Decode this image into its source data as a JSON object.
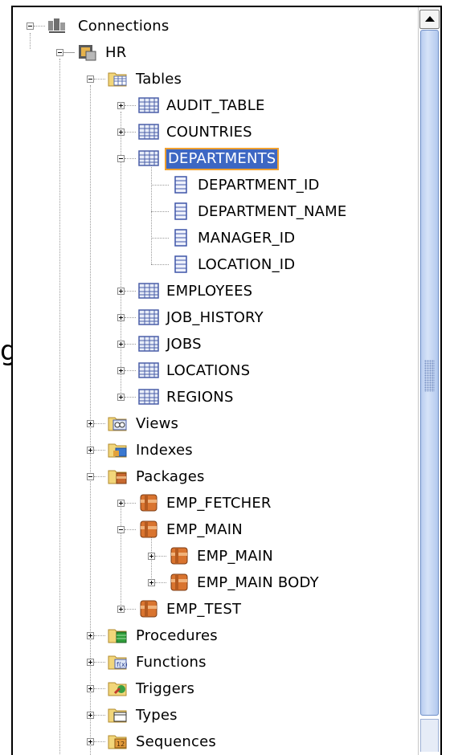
{
  "tree": {
    "connections": "Connections",
    "hr": "HR",
    "tables": {
      "label": "Tables",
      "items": [
        "AUDIT_TABLE",
        "COUNTRIES",
        "DEPARTMENTS",
        "EMPLOYEES",
        "JOB_HISTORY",
        "JOBS",
        "LOCATIONS",
        "REGIONS"
      ]
    },
    "department_columns": [
      "DEPARTMENT_ID",
      "DEPARTMENT_NAME",
      "MANAGER_ID",
      "LOCATION_ID"
    ],
    "views": "Views",
    "indexes": "Indexes",
    "packages": {
      "label": "Packages",
      "items": [
        "EMP_FETCHER",
        "EMP_MAIN",
        "EMP_TEST"
      ],
      "emp_main_children": [
        "EMP_MAIN",
        "EMP_MAIN BODY"
      ]
    },
    "procedures": "Procedures",
    "functions": "Functions",
    "triggers": "Triggers",
    "types": "Types",
    "sequences": "Sequences",
    "selected": "DEPARTMENTS"
  },
  "background_fragment": "g",
  "icons": {
    "connections": "connections-icon",
    "database": "database-icon",
    "folder": "folder-icon",
    "table": "table-icon",
    "column": "column-icon",
    "package": "package-icon"
  },
  "colors": {
    "selection": "#3d67c3",
    "selection_outline": "#f0a030",
    "scrollbar": "#c3d4f1"
  }
}
